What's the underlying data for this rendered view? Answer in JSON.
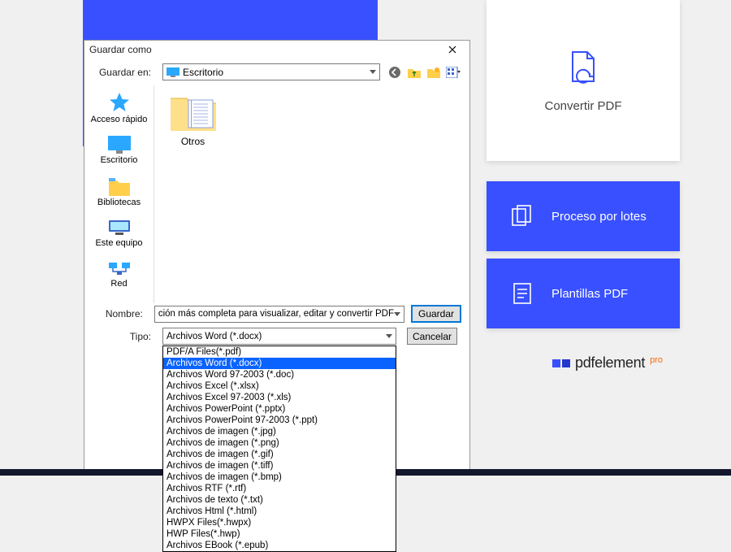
{
  "background": {
    "convert_label": "Convertir PDF",
    "batch_label": "Proceso por lotes",
    "templates_label": "Plantillas PDF",
    "brand_name": "pdfelement",
    "brand_suffix": "pro"
  },
  "dialog": {
    "title": "Guardar como",
    "lookin_label": "Guardar en:",
    "lookin_value": "Escritorio",
    "places": [
      "Acceso rápido",
      "Escritorio",
      "Bibliotecas",
      "Este equipo",
      "Red"
    ],
    "folder_name": "Otros",
    "name_label": "Nombre:",
    "name_value": "ción más completa para visualizar, editar y convertir PDF",
    "type_label": "Tipo:",
    "type_value": "Archivos Word (*.docx)",
    "save_btn": "Guardar",
    "cancel_btn": "Cancelar",
    "options": [
      "PDF/A Files(*.pdf)",
      "Archivos Word (*.docx)",
      "Archivos Word 97-2003 (*.doc)",
      "Archivos Excel (*.xlsx)",
      "Archivos Excel 97-2003 (*.xls)",
      "Archivos PowerPoint (*.pptx)",
      "Archivos PowerPoint 97-2003 (*.ppt)",
      "Archivos de imagen (*.jpg)",
      "Archivos de imagen (*.png)",
      "Archivos de imagen (*.gif)",
      "Archivos de imagen (*.tiff)",
      "Archivos de imagen (*.bmp)",
      "Archivos RTF (*.rtf)",
      "Archivos de texto (*.txt)",
      "Archivos Html (*.html)",
      "HWPX Files(*.hwpx)",
      "HWP Files(*.hwp)",
      "Archivos EBook (*.epub)"
    ],
    "selected_option_index": 1
  }
}
